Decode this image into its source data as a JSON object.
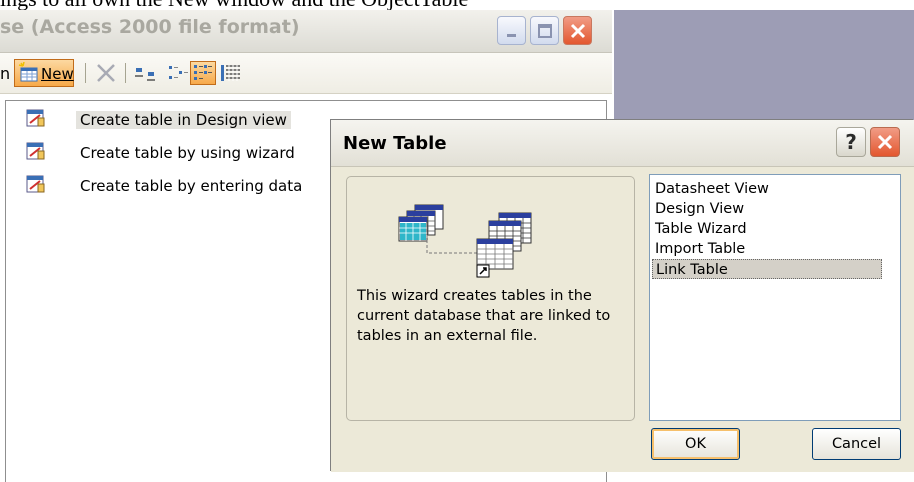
{
  "caption": {
    "text": "ings to all own the New window and the ObjectTable"
  },
  "db_window": {
    "title": "se (Access 2000 file format)",
    "toolbar": {
      "left_partial": "n",
      "new_label": "New"
    },
    "items": [
      {
        "label": "Create table in Design view",
        "selected": true
      },
      {
        "label": "Create table by using wizard",
        "selected": false
      },
      {
        "label": "Create table by entering data",
        "selected": false
      }
    ]
  },
  "dialog": {
    "title": "New Table",
    "help_glyph": "?",
    "description": "This wizard creates tables in the current database that are linked to tables in an external file.",
    "options": [
      "Datasheet View",
      "Design View",
      "Table Wizard",
      "Import Table",
      "Link Table"
    ],
    "selected_option": "Link Table",
    "ok_label": "OK",
    "cancel_label": "Cancel"
  },
  "colors": {
    "accent_orange": "#f7a94a",
    "close_red": "#e3572f",
    "desktop": "#9d9db5"
  },
  "icons": [
    "minimize-icon",
    "maximize-icon",
    "close-icon",
    "new-table-icon",
    "delete-icon",
    "large-icons-view-icon",
    "small-icons-view-icon",
    "list-view-icon",
    "details-view-icon",
    "table-object-icon",
    "help-icon"
  ]
}
